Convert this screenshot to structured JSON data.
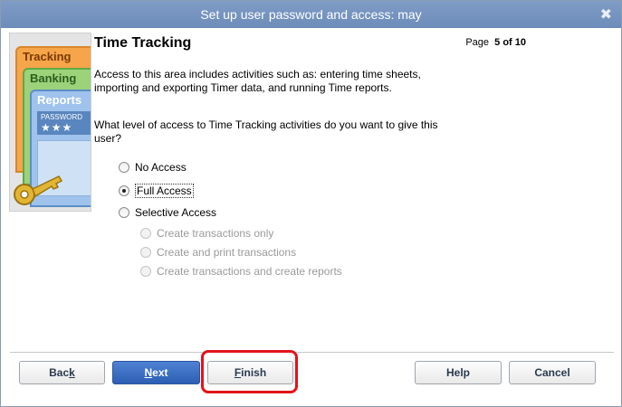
{
  "window": {
    "title": "Set up user password and access: may",
    "close_glyph": "✖"
  },
  "illustration": {
    "tab_tracking": "Tracking",
    "tab_banking": "Banking",
    "tab_reports": "Reports",
    "password_label": "PASSWORD",
    "password_mask": "★★★"
  },
  "heading": "Time Tracking",
  "page": {
    "label": "Page",
    "current": "5 of 10"
  },
  "description": "Access to this area includes activities such as: entering time sheets, importing and exporting Timer data, and running Time reports.",
  "question": "What level of access to Time Tracking activities do you want to give this user?",
  "options": [
    {
      "label": "No Access",
      "checked": false
    },
    {
      "label": "Full Access",
      "checked": true
    },
    {
      "label": "Selective Access",
      "checked": false
    }
  ],
  "sub_options": [
    {
      "label": "Create transactions only"
    },
    {
      "label": "Create and print transactions"
    },
    {
      "label": "Create transactions and create reports"
    }
  ],
  "buttons": {
    "back_pre": "Bac",
    "back_u": "k",
    "back_post": "",
    "next_pre": "",
    "next_u": "N",
    "next_post": "ext",
    "finish_pre": "",
    "finish_u": "F",
    "finish_post": "inish",
    "help": "Help",
    "cancel": "Cancel"
  },
  "colors": {
    "titlebar": "#6d8cb9",
    "primary_button": "#2b5fb3",
    "highlight": "#e0141a"
  }
}
